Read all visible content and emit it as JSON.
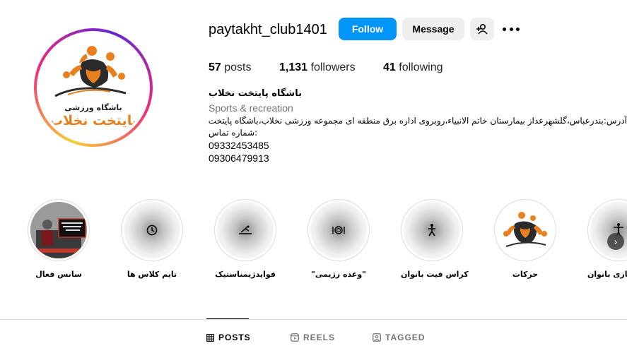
{
  "profile": {
    "username": "paytakht_club1401",
    "logo_text_top": "باشگاه ورزشی",
    "logo_text_bottom": "پایتخت نخلاب"
  },
  "actions": {
    "follow_label": "Follow",
    "message_label": "Message",
    "add_user_icon": "person-plus-icon",
    "more_icon": "more-horizontal-icon"
  },
  "stats": {
    "posts_count": "57",
    "posts_label": "posts",
    "followers_count": "1,131",
    "followers_label": "followers",
    "following_count": "41",
    "following_label": "following"
  },
  "bio": {
    "name": "باشگاه پایتخت نخلاب",
    "category": "Sports & recreation",
    "address": "آدرس:بندرعباس،گلشهرعداز بیمارستان خاتم الانبیاء،روبروی اداره برق منطقه ای مجموعه ورزشی نخلاب،باشگاه پایتخت نخلاب",
    "contact_label": "شماره تماس:",
    "phone1": "09332453485",
    "phone2": "09306479913"
  },
  "highlights": [
    {
      "label": "سانس فعال",
      "icon": "class-photo-icon"
    },
    {
      "label": "تایم کلاس ها",
      "icon": "clock-icon"
    },
    {
      "label": "فوایدژیمناستیک",
      "icon": "gymnast-icon"
    },
    {
      "label": "\"وعده رژیمی\"",
      "icon": "plate-icon"
    },
    {
      "label": "کراس فیت بانوان",
      "icon": "crossfit-icon"
    },
    {
      "label": "حرکات",
      "icon": "club-logo-icon"
    },
    {
      "label": "بدنسازی بانوان",
      "icon": "bodybuilding-icon"
    }
  ],
  "tabs": [
    {
      "label": "POSTS",
      "icon": "grid-icon",
      "active": true
    },
    {
      "label": "REELS",
      "icon": "reels-icon",
      "active": false
    },
    {
      "label": "TAGGED",
      "icon": "tagged-icon",
      "active": false
    }
  ],
  "colors": {
    "accent": "#0095f6",
    "logo_orange": "#e8801f"
  }
}
